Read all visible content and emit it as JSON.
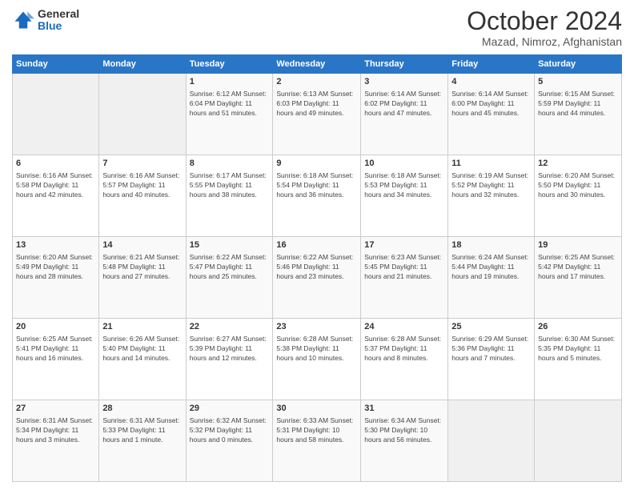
{
  "logo": {
    "general": "General",
    "blue": "Blue"
  },
  "title": "October 2024",
  "location": "Mazad, Nimroz, Afghanistan",
  "days_of_week": [
    "Sunday",
    "Monday",
    "Tuesday",
    "Wednesday",
    "Thursday",
    "Friday",
    "Saturday"
  ],
  "weeks": [
    [
      {
        "day": "",
        "detail": ""
      },
      {
        "day": "",
        "detail": ""
      },
      {
        "day": "1",
        "detail": "Sunrise: 6:12 AM\nSunset: 6:04 PM\nDaylight: 11 hours and 51 minutes."
      },
      {
        "day": "2",
        "detail": "Sunrise: 6:13 AM\nSunset: 6:03 PM\nDaylight: 11 hours and 49 minutes."
      },
      {
        "day": "3",
        "detail": "Sunrise: 6:14 AM\nSunset: 6:02 PM\nDaylight: 11 hours and 47 minutes."
      },
      {
        "day": "4",
        "detail": "Sunrise: 6:14 AM\nSunset: 6:00 PM\nDaylight: 11 hours and 45 minutes."
      },
      {
        "day": "5",
        "detail": "Sunrise: 6:15 AM\nSunset: 5:59 PM\nDaylight: 11 hours and 44 minutes."
      }
    ],
    [
      {
        "day": "6",
        "detail": "Sunrise: 6:16 AM\nSunset: 5:58 PM\nDaylight: 11 hours and 42 minutes."
      },
      {
        "day": "7",
        "detail": "Sunrise: 6:16 AM\nSunset: 5:57 PM\nDaylight: 11 hours and 40 minutes."
      },
      {
        "day": "8",
        "detail": "Sunrise: 6:17 AM\nSunset: 5:55 PM\nDaylight: 11 hours and 38 minutes."
      },
      {
        "day": "9",
        "detail": "Sunrise: 6:18 AM\nSunset: 5:54 PM\nDaylight: 11 hours and 36 minutes."
      },
      {
        "day": "10",
        "detail": "Sunrise: 6:18 AM\nSunset: 5:53 PM\nDaylight: 11 hours and 34 minutes."
      },
      {
        "day": "11",
        "detail": "Sunrise: 6:19 AM\nSunset: 5:52 PM\nDaylight: 11 hours and 32 minutes."
      },
      {
        "day": "12",
        "detail": "Sunrise: 6:20 AM\nSunset: 5:50 PM\nDaylight: 11 hours and 30 minutes."
      }
    ],
    [
      {
        "day": "13",
        "detail": "Sunrise: 6:20 AM\nSunset: 5:49 PM\nDaylight: 11 hours and 28 minutes."
      },
      {
        "day": "14",
        "detail": "Sunrise: 6:21 AM\nSunset: 5:48 PM\nDaylight: 11 hours and 27 minutes."
      },
      {
        "day": "15",
        "detail": "Sunrise: 6:22 AM\nSunset: 5:47 PM\nDaylight: 11 hours and 25 minutes."
      },
      {
        "day": "16",
        "detail": "Sunrise: 6:22 AM\nSunset: 5:46 PM\nDaylight: 11 hours and 23 minutes."
      },
      {
        "day": "17",
        "detail": "Sunrise: 6:23 AM\nSunset: 5:45 PM\nDaylight: 11 hours and 21 minutes."
      },
      {
        "day": "18",
        "detail": "Sunrise: 6:24 AM\nSunset: 5:44 PM\nDaylight: 11 hours and 19 minutes."
      },
      {
        "day": "19",
        "detail": "Sunrise: 6:25 AM\nSunset: 5:42 PM\nDaylight: 11 hours and 17 minutes."
      }
    ],
    [
      {
        "day": "20",
        "detail": "Sunrise: 6:25 AM\nSunset: 5:41 PM\nDaylight: 11 hours and 16 minutes."
      },
      {
        "day": "21",
        "detail": "Sunrise: 6:26 AM\nSunset: 5:40 PM\nDaylight: 11 hours and 14 minutes."
      },
      {
        "day": "22",
        "detail": "Sunrise: 6:27 AM\nSunset: 5:39 PM\nDaylight: 11 hours and 12 minutes."
      },
      {
        "day": "23",
        "detail": "Sunrise: 6:28 AM\nSunset: 5:38 PM\nDaylight: 11 hours and 10 minutes."
      },
      {
        "day": "24",
        "detail": "Sunrise: 6:28 AM\nSunset: 5:37 PM\nDaylight: 11 hours and 8 minutes."
      },
      {
        "day": "25",
        "detail": "Sunrise: 6:29 AM\nSunset: 5:36 PM\nDaylight: 11 hours and 7 minutes."
      },
      {
        "day": "26",
        "detail": "Sunrise: 6:30 AM\nSunset: 5:35 PM\nDaylight: 11 hours and 5 minutes."
      }
    ],
    [
      {
        "day": "27",
        "detail": "Sunrise: 6:31 AM\nSunset: 5:34 PM\nDaylight: 11 hours and 3 minutes."
      },
      {
        "day": "28",
        "detail": "Sunrise: 6:31 AM\nSunset: 5:33 PM\nDaylight: 11 hours and 1 minute."
      },
      {
        "day": "29",
        "detail": "Sunrise: 6:32 AM\nSunset: 5:32 PM\nDaylight: 11 hours and 0 minutes."
      },
      {
        "day": "30",
        "detail": "Sunrise: 6:33 AM\nSunset: 5:31 PM\nDaylight: 10 hours and 58 minutes."
      },
      {
        "day": "31",
        "detail": "Sunrise: 6:34 AM\nSunset: 5:30 PM\nDaylight: 10 hours and 56 minutes."
      },
      {
        "day": "",
        "detail": ""
      },
      {
        "day": "",
        "detail": ""
      }
    ]
  ]
}
